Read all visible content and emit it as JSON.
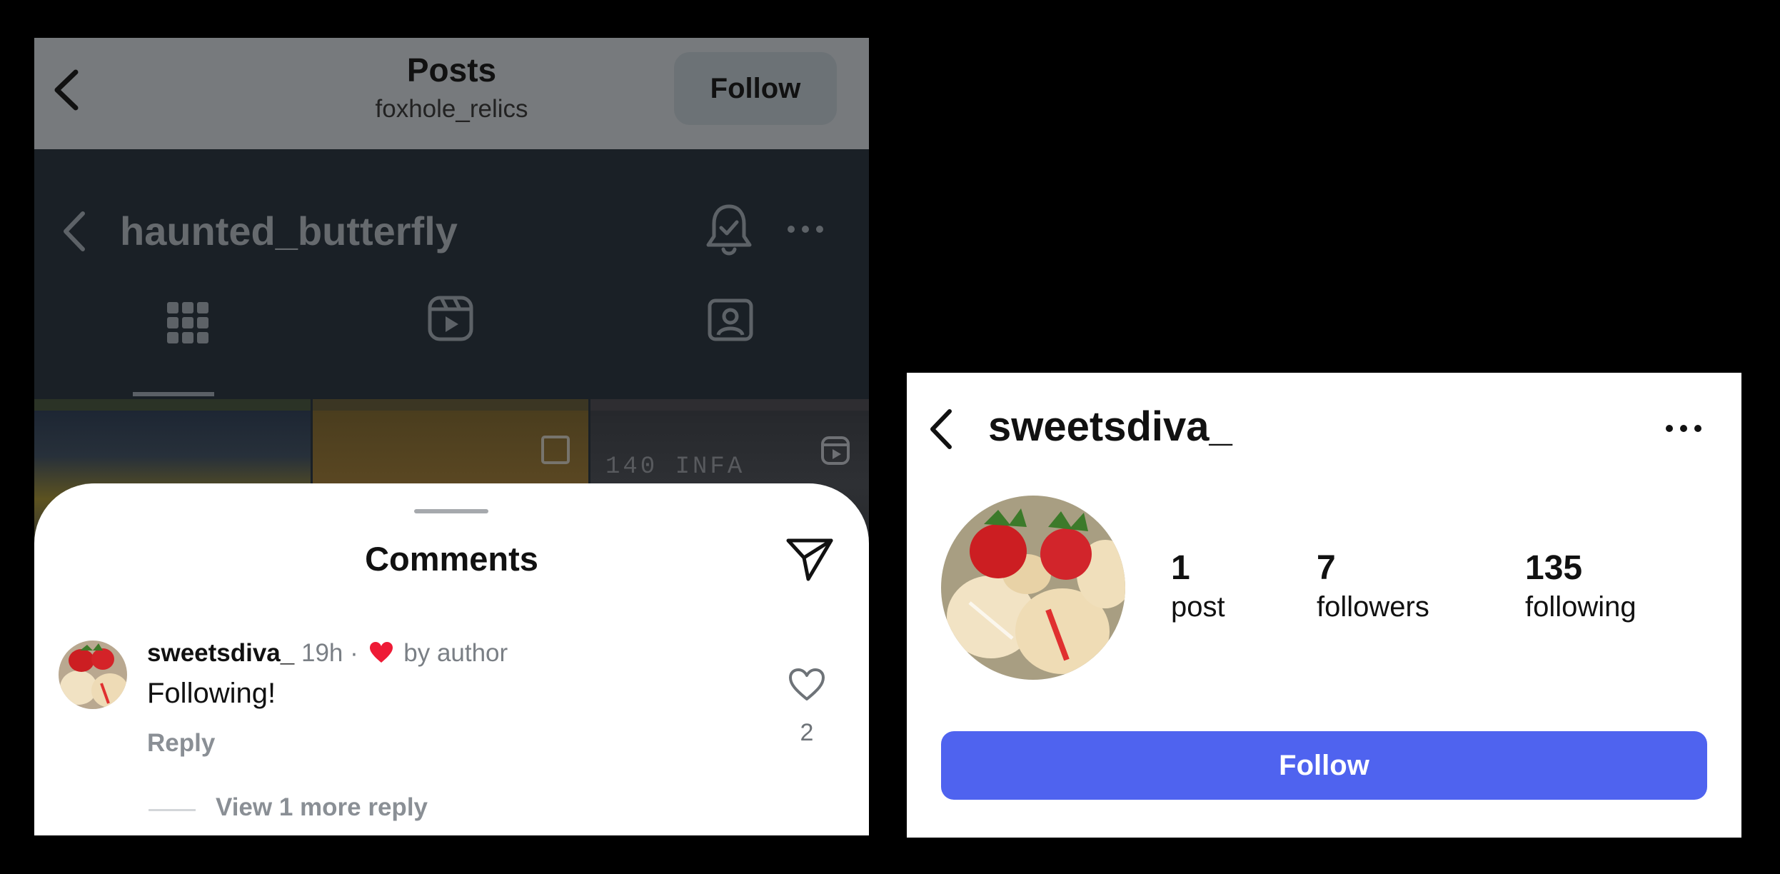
{
  "left_screen": {
    "header": {
      "title": "Posts",
      "subtitle": "foxhole_relics",
      "follow_label": "Follow"
    },
    "profile_bar": {
      "username": "haunted_butterfly"
    },
    "thumbnails": {
      "thumb_3_text": "140 INFA"
    },
    "comments_sheet": {
      "title": "Comments",
      "comment": {
        "username": "sweetsdiva_",
        "time": "19h",
        "separator": "·",
        "liked_by": "by author",
        "text": "Following!",
        "reply_label": "Reply",
        "like_count": "2"
      },
      "view_more_label": "View 1 more reply"
    }
  },
  "right_screen": {
    "username": "sweetsdiva_",
    "stats": [
      {
        "value": "1",
        "label": "post"
      },
      {
        "value": "7",
        "label": "followers"
      },
      {
        "value": "135",
        "label": "following"
      }
    ],
    "follow_label": "Follow",
    "accent_color": "#4f63ef"
  },
  "icons": {
    "back": "chevron-left-icon",
    "bell": "bell-check-icon",
    "more": "more-horizontal-icon",
    "grid": "grid-icon",
    "reels": "reels-icon",
    "tagged": "tagged-icon",
    "share": "paper-plane-icon",
    "heart": "heart-icon"
  }
}
